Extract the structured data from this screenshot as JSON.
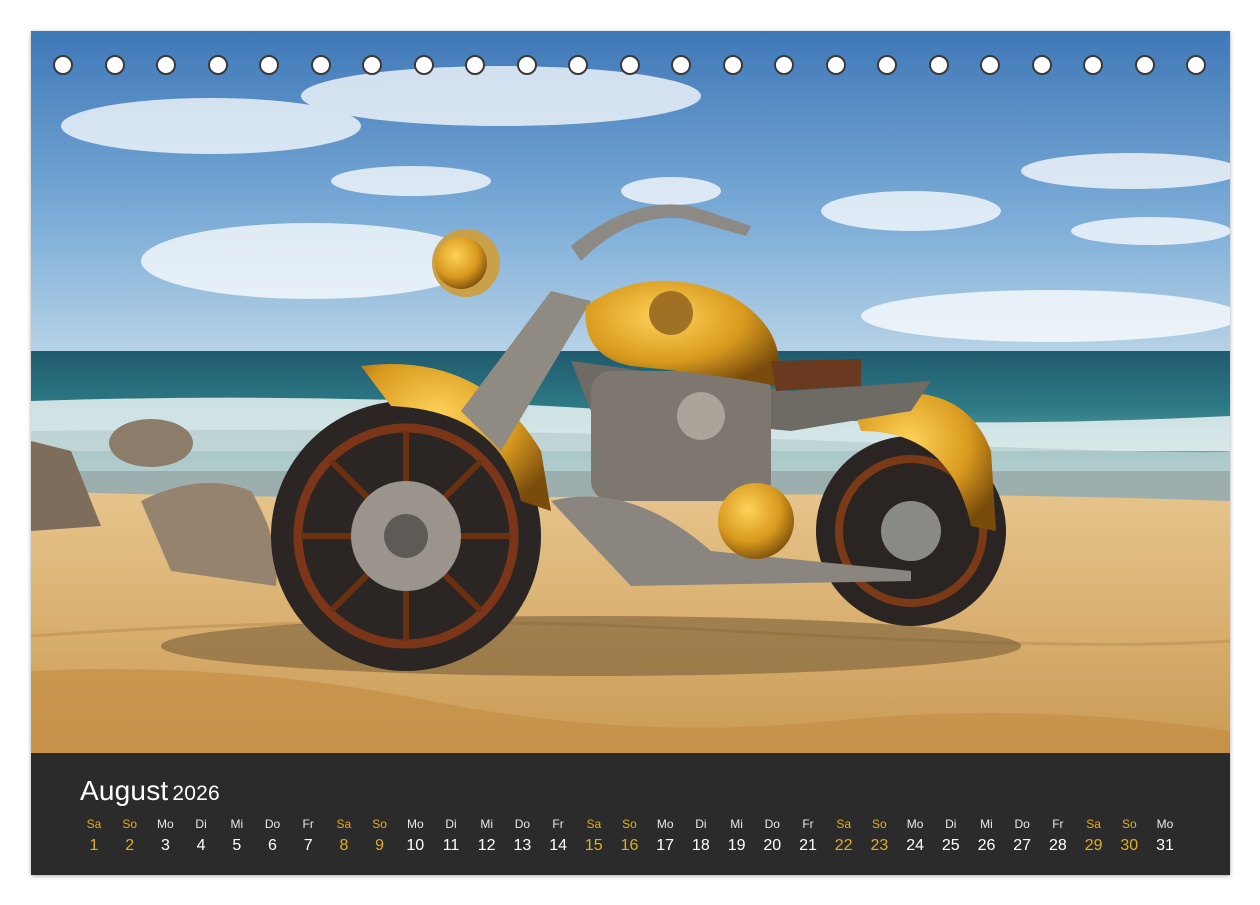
{
  "calendar": {
    "month": "August",
    "year": "2026",
    "days": [
      {
        "wd": "Sa",
        "d": "1",
        "we": true
      },
      {
        "wd": "So",
        "d": "2",
        "we": true
      },
      {
        "wd": "Mo",
        "d": "3",
        "we": false
      },
      {
        "wd": "Di",
        "d": "4",
        "we": false
      },
      {
        "wd": "Mi",
        "d": "5",
        "we": false
      },
      {
        "wd": "Do",
        "d": "6",
        "we": false
      },
      {
        "wd": "Fr",
        "d": "7",
        "we": false
      },
      {
        "wd": "Sa",
        "d": "8",
        "we": true
      },
      {
        "wd": "So",
        "d": "9",
        "we": true
      },
      {
        "wd": "Mo",
        "d": "10",
        "we": false
      },
      {
        "wd": "Di",
        "d": "11",
        "we": false
      },
      {
        "wd": "Mi",
        "d": "12",
        "we": false
      },
      {
        "wd": "Do",
        "d": "13",
        "we": false
      },
      {
        "wd": "Fr",
        "d": "14",
        "we": false
      },
      {
        "wd": "Sa",
        "d": "15",
        "we": true
      },
      {
        "wd": "So",
        "d": "16",
        "we": true
      },
      {
        "wd": "Mo",
        "d": "17",
        "we": false
      },
      {
        "wd": "Di",
        "d": "18",
        "we": false
      },
      {
        "wd": "Mi",
        "d": "19",
        "we": false
      },
      {
        "wd": "Do",
        "d": "20",
        "we": false
      },
      {
        "wd": "Fr",
        "d": "21",
        "we": false
      },
      {
        "wd": "Sa",
        "d": "22",
        "we": true
      },
      {
        "wd": "So",
        "d": "23",
        "we": true
      },
      {
        "wd": "Mo",
        "d": "24",
        "we": false
      },
      {
        "wd": "Di",
        "d": "25",
        "we": false
      },
      {
        "wd": "Mi",
        "d": "26",
        "we": false
      },
      {
        "wd": "Do",
        "d": "27",
        "we": false
      },
      {
        "wd": "Fr",
        "d": "28",
        "we": false
      },
      {
        "wd": "Sa",
        "d": "29",
        "we": true
      },
      {
        "wd": "So",
        "d": "30",
        "we": true
      },
      {
        "wd": "Mo",
        "d": "31",
        "we": false
      }
    ]
  },
  "colors": {
    "band": "#2b2b2b",
    "weekend": "#e1ad1e",
    "weekday": "#ffffff"
  }
}
